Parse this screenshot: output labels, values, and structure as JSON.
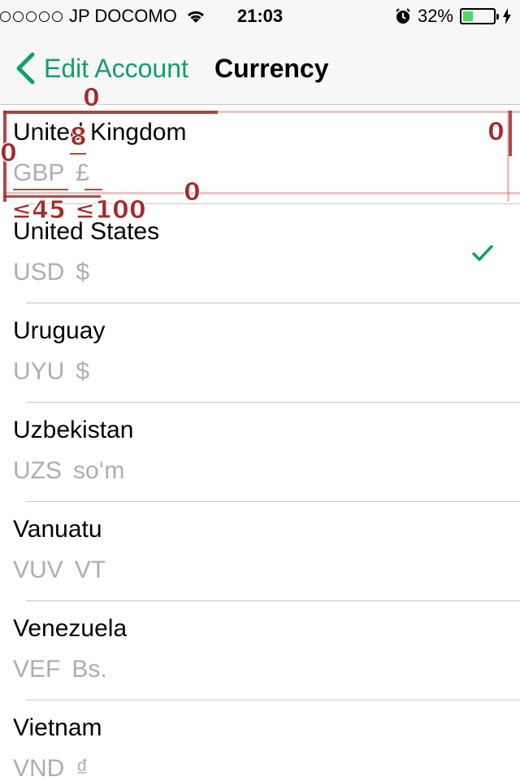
{
  "status_bar": {
    "carrier": "JP DOCOMO",
    "time": "21:03",
    "battery_percent_text": "32%",
    "battery_level": 0.32,
    "icons": [
      "signal-dots-icon",
      "wifi-icon",
      "alarm-icon",
      "battery-icon",
      "charging-bolt-icon"
    ]
  },
  "nav": {
    "back_label": "Edit Account",
    "title": "Currency"
  },
  "colors": {
    "accent": "#11a06a",
    "secondary_text": "#aeaeb2",
    "overlay_red": "#a52a2a"
  },
  "currencies": [
    {
      "country": "United Kingdom",
      "code": "GBP",
      "symbol": "£",
      "selected": false
    },
    {
      "country": "United States",
      "code": "USD",
      "symbol": "$",
      "selected": true
    },
    {
      "country": "Uruguay",
      "code": "UYU",
      "symbol": "$",
      "selected": false
    },
    {
      "country": "Uzbekistan",
      "code": "UZS",
      "symbol": "so‘m",
      "selected": false
    },
    {
      "country": "Vanuatu",
      "code": "VUV",
      "symbol": "VT",
      "selected": false
    },
    {
      "country": "Venezuela",
      "code": "VEF",
      "symbol": "Bs.",
      "selected": false
    },
    {
      "country": "Vietnam",
      "code": "VND",
      "symbol": "₫",
      "selected": false
    }
  ],
  "overlay_annotations": {
    "top": "0",
    "gap": "8",
    "right": "0",
    "left": "0",
    "bottom": "0",
    "code_width": "≤45",
    "symbol_width": "≤100"
  }
}
